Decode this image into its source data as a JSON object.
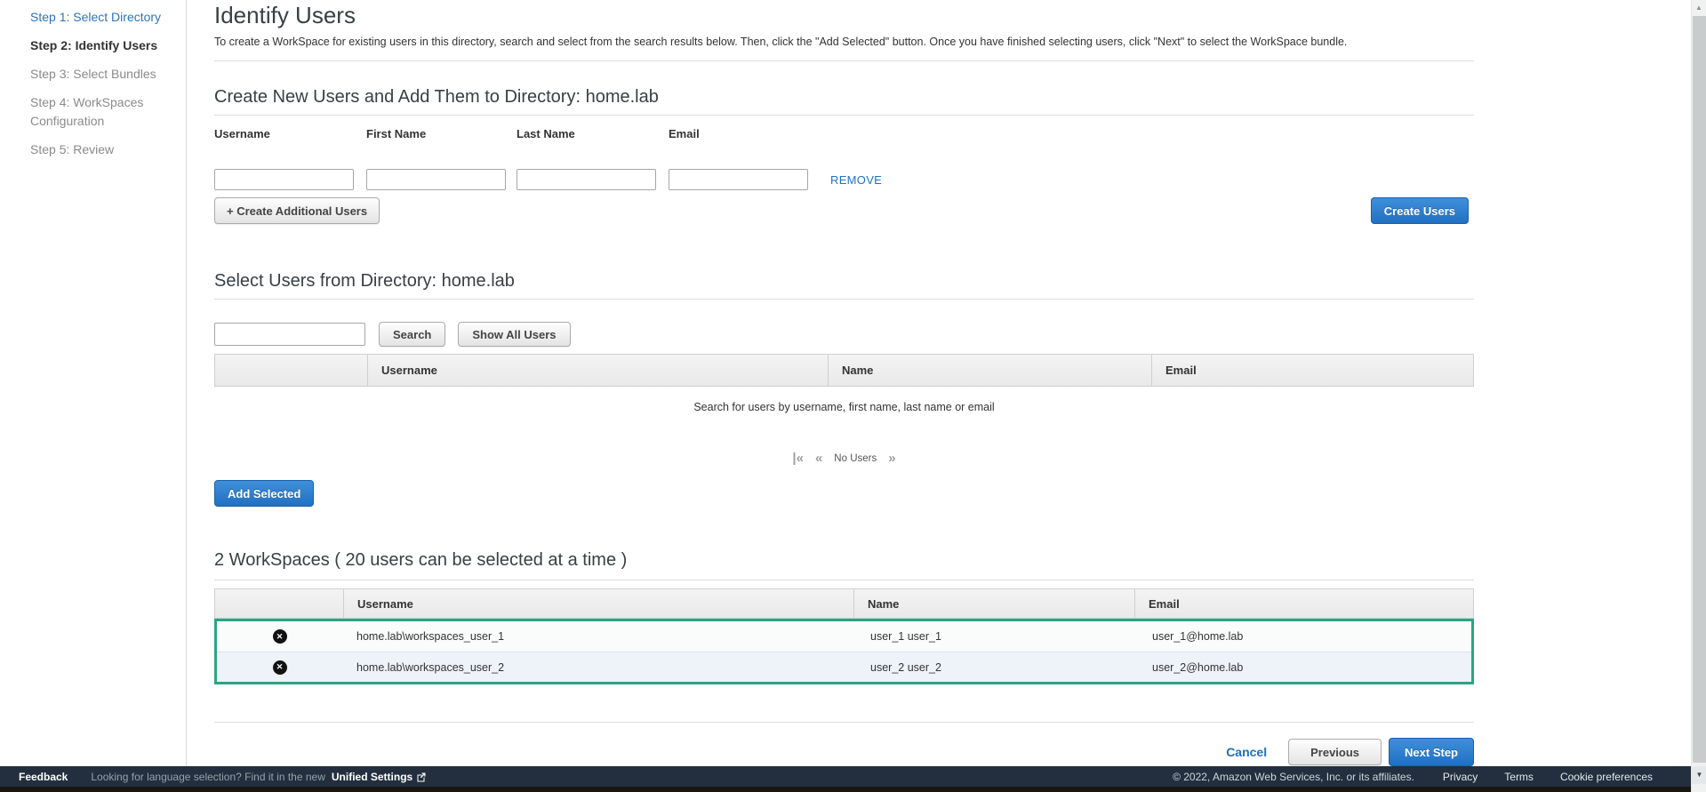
{
  "sidebar": {
    "steps": [
      {
        "label": "Step 1: Select Directory",
        "state": "completed-link"
      },
      {
        "label": "Step 2: Identify Users",
        "state": "current"
      },
      {
        "label": "Step 3: Select Bundles",
        "state": "upcoming"
      },
      {
        "label": "Step 4: WorkSpaces Configuration",
        "state": "upcoming"
      },
      {
        "label": "Step 5: Review",
        "state": "upcoming"
      }
    ]
  },
  "header": {
    "title": "Identify Users",
    "description": "To create a WorkSpace for existing users in this directory, search and select from the search results below. Then, click the \"Add Selected\" button. Once you have finished selecting users, click \"Next\" to select the WorkSpace bundle."
  },
  "create_section": {
    "title": "Create New Users and Add Them to Directory: home.lab",
    "fields": [
      {
        "label": "Username",
        "value": ""
      },
      {
        "label": "First Name",
        "value": ""
      },
      {
        "label": "Last Name",
        "value": ""
      },
      {
        "label": "Email",
        "value": ""
      }
    ],
    "remove_label": "REMOVE",
    "add_button": "+ Create Additional Users",
    "create_button": "Create Users"
  },
  "select_section": {
    "title": "Select Users from Directory: home.lab",
    "search_value": "",
    "search_button": "Search",
    "show_all_button": "Show All Users",
    "table_headers": [
      "",
      "Username",
      "Name",
      "Email"
    ],
    "empty_message": "Search for users by username, first name, last name or email",
    "pagination_label": "No Users",
    "add_selected_button": "Add Selected"
  },
  "workspaces_section": {
    "title": "2 WorkSpaces ( 20 users can be selected at a time )",
    "table_headers": [
      "",
      "Username",
      "Name",
      "Email"
    ],
    "rows": [
      {
        "username": "home.lab\\workspaces_user_1",
        "name": "user_1 user_1",
        "email": "user_1@home.lab"
      },
      {
        "username": "home.lab\\workspaces_user_2",
        "name": "user_2 user_2",
        "email": "user_2@home.lab"
      }
    ]
  },
  "footer_nav": {
    "cancel": "Cancel",
    "previous": "Previous",
    "next": "Next Step"
  },
  "footer": {
    "feedback": "Feedback",
    "language_text": "Looking for language selection? Find it in the new",
    "unified_settings": "Unified Settings",
    "copyright": "© 2022, Amazon Web Services, Inc. or its affiliates.",
    "privacy": "Privacy",
    "terms": "Terms",
    "cookie_preferences": "Cookie preferences"
  },
  "icons": {
    "first_page": "|«",
    "previous_page": "«",
    "next_page": "»",
    "remove_x": "✕",
    "scroll_up": "▲",
    "scroll_down": "▼"
  },
  "colors": {
    "primary_button_blue": "#2673c4",
    "link_blue": "#1a70c0",
    "selection_green": "#29a584",
    "footer_bg": "#232f3e",
    "sidebar_link_blue": "#2d74b9"
  }
}
